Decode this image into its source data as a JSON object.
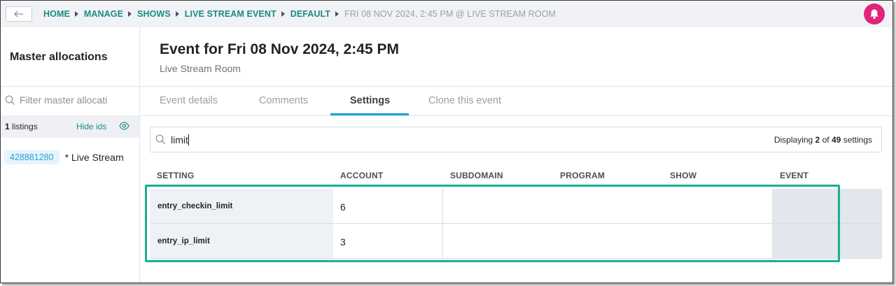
{
  "breadcrumb": {
    "items": [
      "HOME",
      "MANAGE",
      "SHOWS",
      "LIVE STREAM EVENT",
      "DEFAULT"
    ],
    "current": "FRI 08 NOV 2024, 2:45 PM @ LIVE STREAM ROOM"
  },
  "icons": {
    "back": "arrow-left-icon",
    "notifications": "bell-icon",
    "search": "search-icon",
    "visibility": "eye-icon"
  },
  "colors": {
    "accent": "#1a8a86",
    "link": "#1e9fd8",
    "bell": "#e2237a",
    "highlight": "#16b096"
  },
  "sidebar": {
    "title": "Master allocations",
    "filter_placeholder": "Filter master allocati",
    "listings_count": "1",
    "listings_label": "listings",
    "hide_ids": "Hide ids",
    "listings": [
      {
        "id": "428881280",
        "name": "* Live Stream"
      }
    ]
  },
  "event": {
    "title": "Event for Fri 08 Nov 2024, 2:45 PM",
    "venue": "Live Stream Room"
  },
  "tabs": [
    {
      "label": "Event details",
      "active": false
    },
    {
      "label": "Comments",
      "active": false
    },
    {
      "label": "Settings",
      "active": true
    },
    {
      "label": "Clone this event",
      "active": false
    }
  ],
  "settings": {
    "search_value": "limit",
    "displaying_prefix": "Displaying",
    "shown": "2",
    "of": "of",
    "total": "49",
    "suffix": "settings",
    "columns": [
      "SETTING",
      "ACCOUNT",
      "SUBDOMAIN",
      "PROGRAM",
      "SHOW",
      "EVENT"
    ],
    "rows": [
      {
        "name": "entry_checkin_limit",
        "account": "6"
      },
      {
        "name": "entry_ip_limit",
        "account": "3"
      }
    ]
  }
}
